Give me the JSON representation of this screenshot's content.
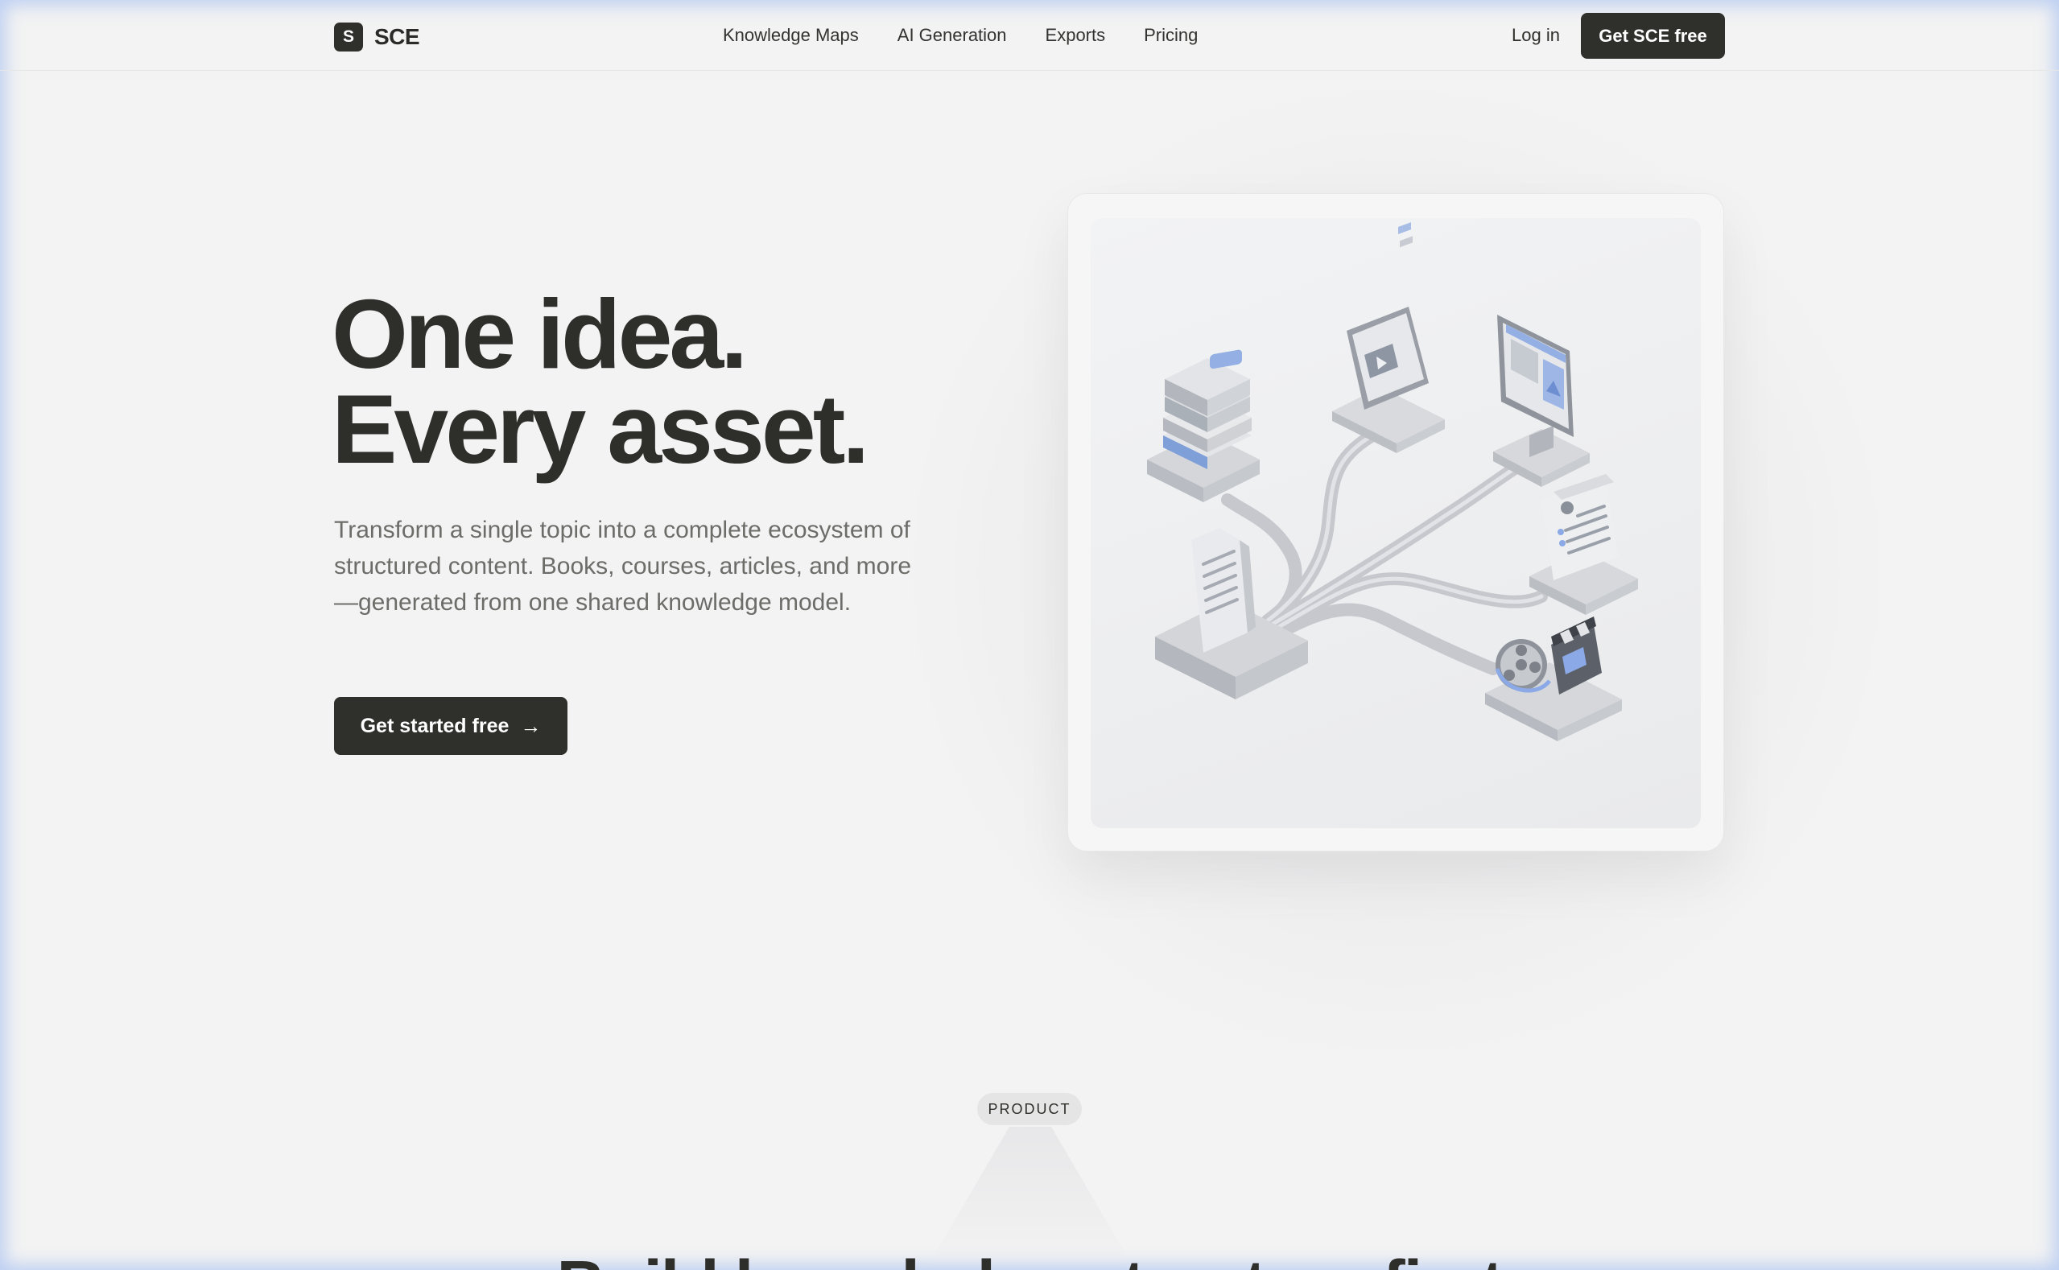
{
  "nav": {
    "logo_letter": "S",
    "brand": "SCE",
    "links": [
      "Knowledge Maps",
      "AI Generation",
      "Exports",
      "Pricing"
    ],
    "login": "Log in",
    "cta": "Get SCE free"
  },
  "hero": {
    "title_line1": "One idea.",
    "title_line2": "Every asset.",
    "subtitle": "Transform a single topic into a complete ecosystem of structured content. Books, courses, articles, and more—generated from one shared knowledge model.",
    "cta": "Get started free",
    "cta_arrow": "→"
  },
  "product": {
    "badge": "PRODUCT",
    "heading": "Build knowledge structure first"
  },
  "colors": {
    "dark": "#2f2f2c",
    "accent_blue": "#8aa9e6",
    "muted_text": "#6c6c69"
  }
}
